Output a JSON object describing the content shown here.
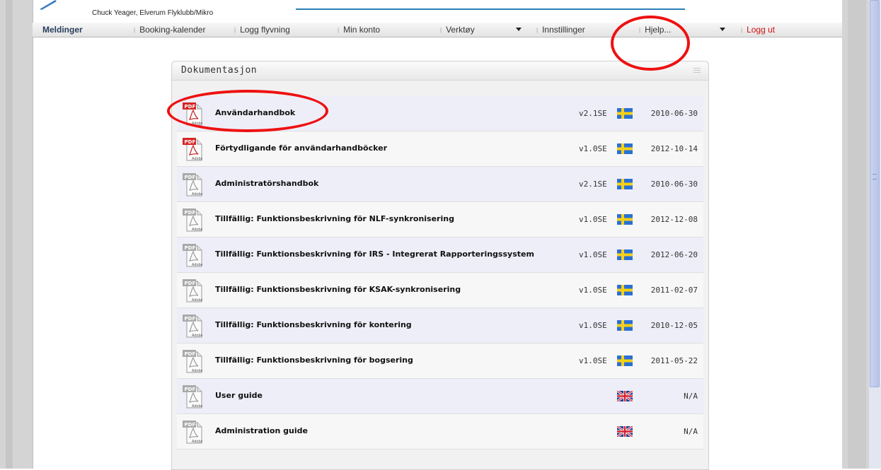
{
  "header": {
    "user_info": "Chuck Yeager, Elverum Flyklubb/Mikro"
  },
  "nav": {
    "items": [
      {
        "label": "Meldinger"
      },
      {
        "label": "Booking-kalender"
      },
      {
        "label": "Logg flyvning"
      },
      {
        "label": "Min konto"
      },
      {
        "label": "Verktøy"
      },
      {
        "label": "Innstillinger"
      },
      {
        "label": "Hjelp..."
      },
      {
        "label": "Logg ut"
      }
    ]
  },
  "panel": {
    "title": "Dokumentasjon"
  },
  "documents": [
    {
      "title": "Användarhandbok",
      "version": "v2.1SE",
      "language": "swedish-flag-icon",
      "date": "2010-06-30",
      "icon": "pdf-red-icon"
    },
    {
      "title": "Förtydligande för användarhandböcker",
      "version": "v1.0SE",
      "language": "swedish-flag-icon",
      "date": "2012-10-14",
      "icon": "pdf-red-icon"
    },
    {
      "title": "Administratörshandbok",
      "version": "v2.1SE",
      "language": "swedish-flag-icon",
      "date": "2010-06-30",
      "icon": "pdf-grey-icon"
    },
    {
      "title": "Tillfällig: Funktionsbeskrivning för NLF-synkronisering",
      "version": "v1.0SE",
      "language": "swedish-flag-icon",
      "date": "2012-12-08",
      "icon": "pdf-grey-icon"
    },
    {
      "title": "Tillfällig: Funktionsbeskrivning för IRS - Integrerat Rapporteringssystem",
      "version": "v1.0SE",
      "language": "swedish-flag-icon",
      "date": "2012-06-20",
      "icon": "pdf-grey-icon"
    },
    {
      "title": "Tillfällig: Funktionsbeskrivning för KSAK-synkronisering",
      "version": "v1.0SE",
      "language": "swedish-flag-icon",
      "date": "2011-02-07",
      "icon": "pdf-grey-icon"
    },
    {
      "title": "Tillfällig: Funktionsbeskrivning för kontering",
      "version": "v1.0SE",
      "language": "swedish-flag-icon",
      "date": "2010-12-05",
      "icon": "pdf-grey-icon"
    },
    {
      "title": "Tillfällig: Funktionsbeskrivning för bogsering",
      "version": "v1.0SE",
      "language": "swedish-flag-icon",
      "date": "2011-05-22",
      "icon": "pdf-grey-icon"
    },
    {
      "title": "User guide",
      "version": "",
      "language": "uk-flag-icon",
      "date": "N/A",
      "icon": "pdf-grey-icon"
    },
    {
      "title": "Administration guide",
      "version": "",
      "language": "uk-flag-icon",
      "date": "N/A",
      "icon": "pdf-grey-icon"
    }
  ],
  "colors": {
    "accent_blue": "#2b7fb8",
    "logout_red": "#d01010",
    "annotation_red": "#ee1111",
    "row_odd": "#eeeef9",
    "row_even": "#f7f7f7"
  }
}
